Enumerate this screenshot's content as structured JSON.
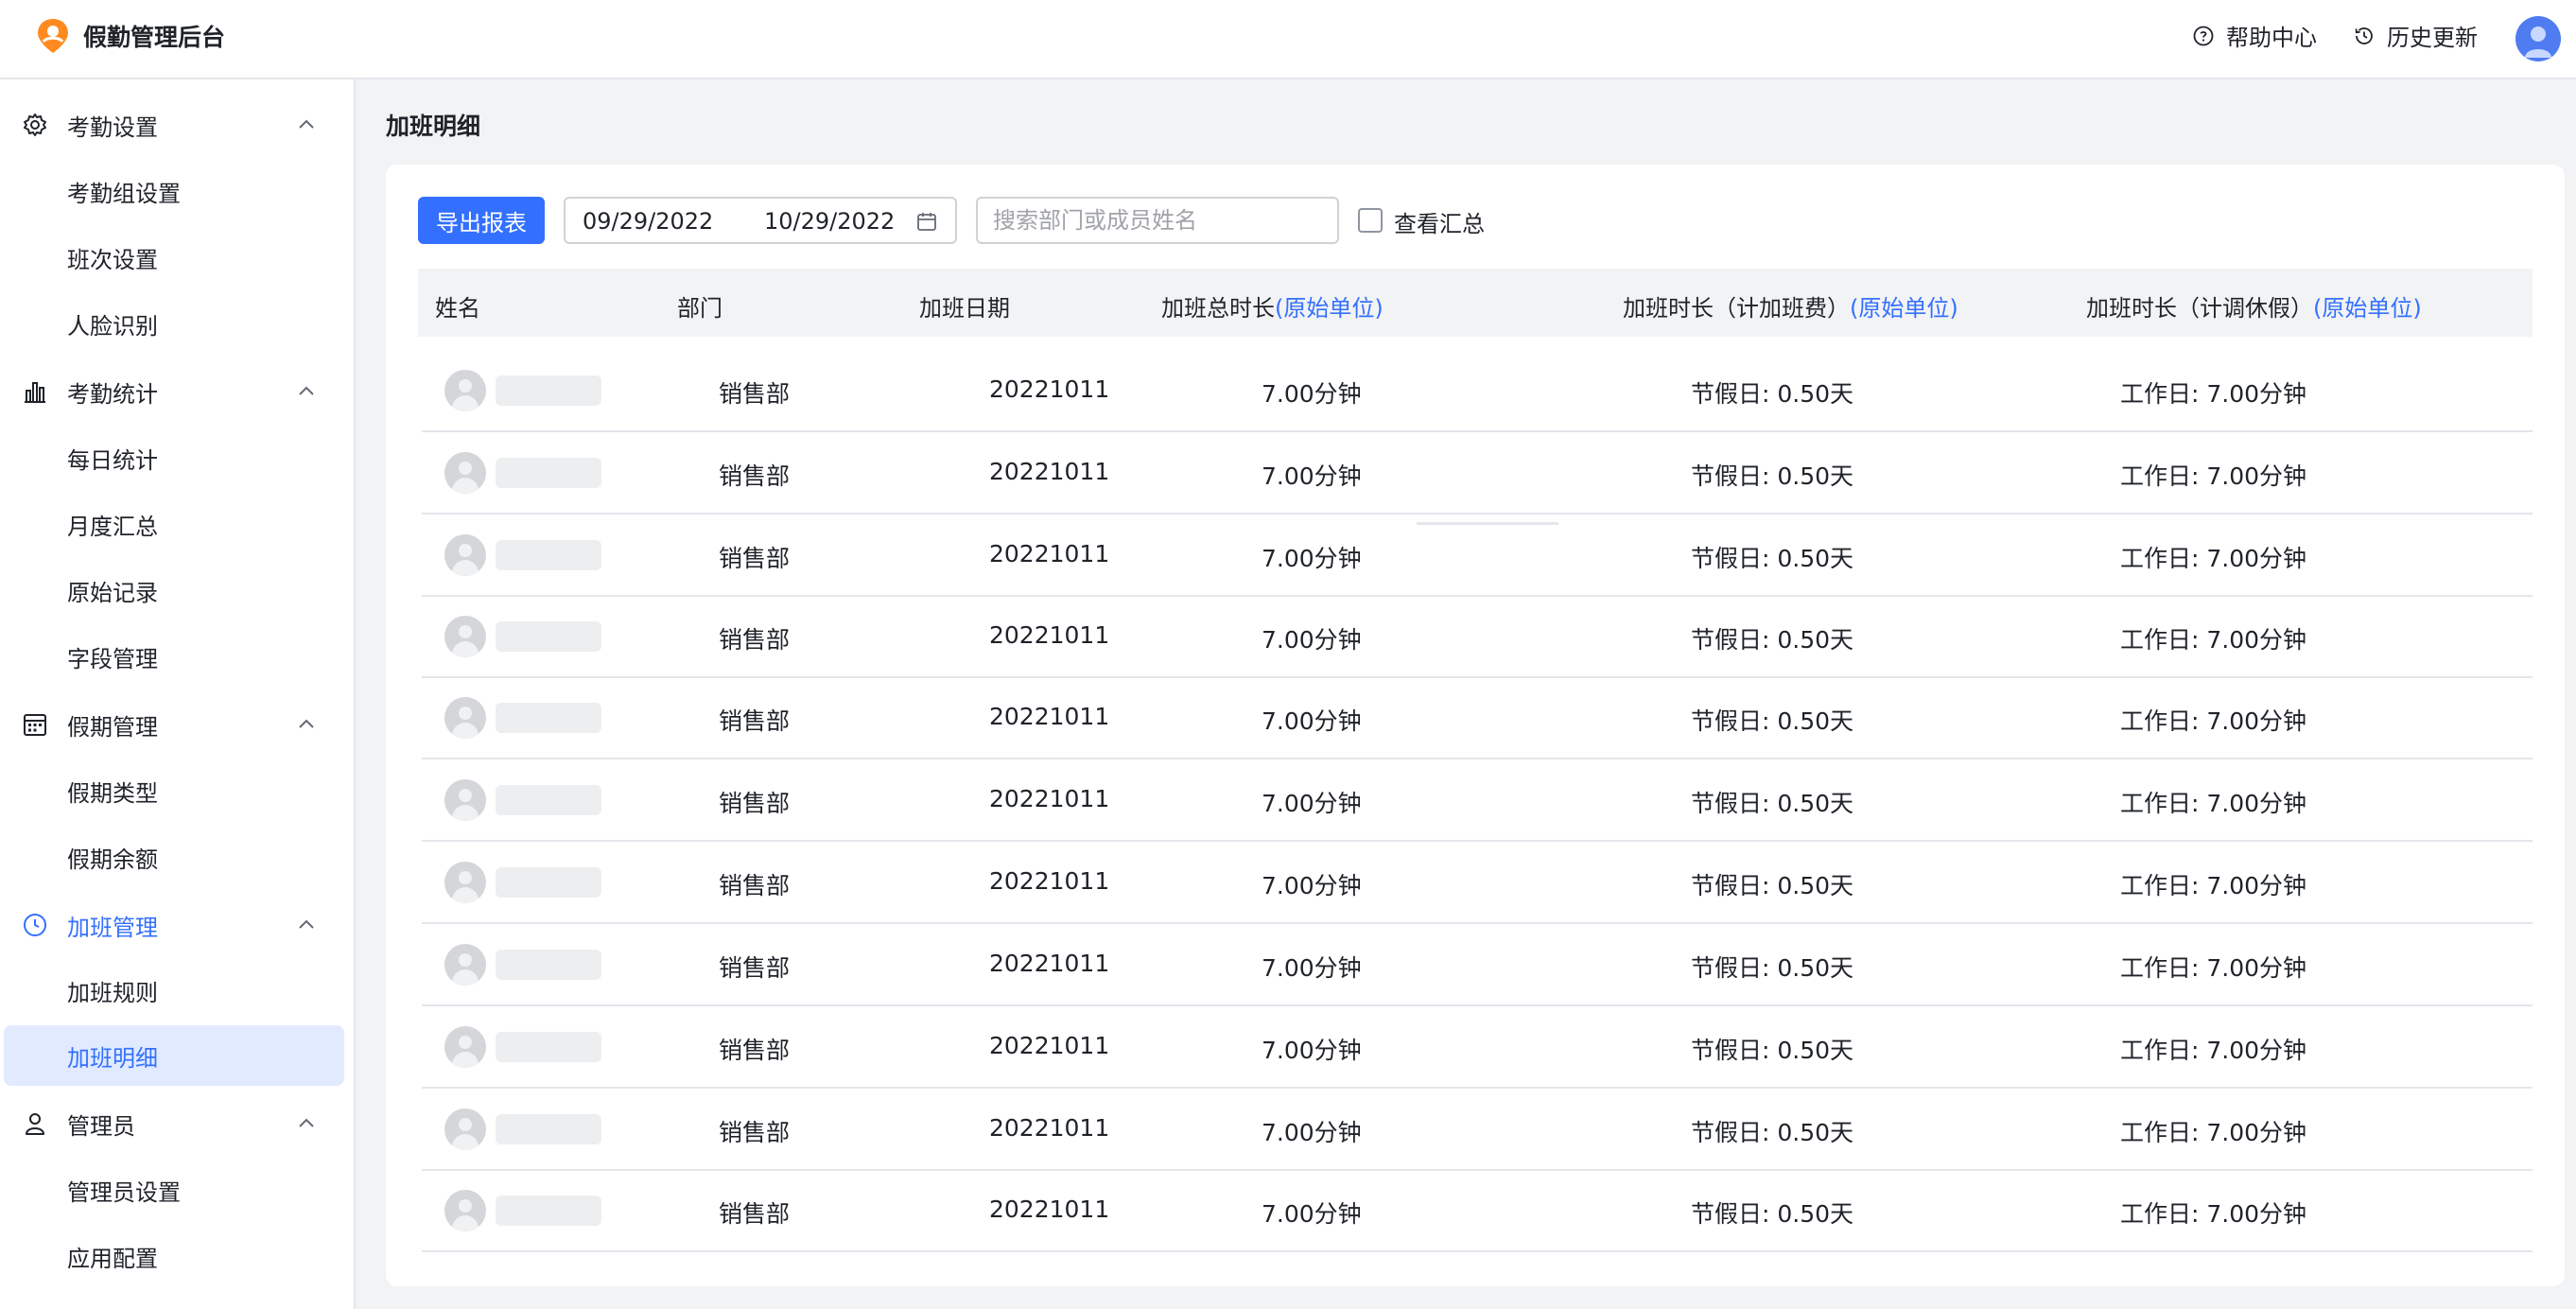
{
  "header": {
    "app_title": "假勤管理后台",
    "help_label": "帮助中心",
    "history_label": "历史更新",
    "icons": {
      "logo": "location-pin-logo-icon",
      "help": "question-circle-icon",
      "history": "history-clock-icon",
      "user": "user-avatar-icon"
    }
  },
  "sidebar": {
    "groups": [
      {
        "label": "考勤设置",
        "icon": "gear-icon",
        "items": [
          "考勤组设置",
          "班次设置",
          "人脸识别"
        ]
      },
      {
        "label": "考勤统计",
        "icon": "bar-chart-icon",
        "items": [
          "每日统计",
          "月度汇总",
          "原始记录",
          "字段管理"
        ]
      },
      {
        "label": "假期管理",
        "icon": "calendar-grid-icon",
        "items": [
          "假期类型",
          "假期余额"
        ]
      },
      {
        "label": "加班管理",
        "icon": "clock-icon",
        "items": [
          "加班规则",
          "加班明细"
        ]
      },
      {
        "label": "管理员",
        "icon": "person-icon",
        "items": [
          "管理员设置",
          "应用配置"
        ]
      }
    ],
    "active_group": "加班管理",
    "selected_item": "加班明细"
  },
  "page": {
    "title": "加班明细"
  },
  "toolbar": {
    "export_label": "导出报表",
    "date_start": "09/29/2022",
    "date_end": "10/29/2022",
    "search_placeholder": "搜索部门或成员姓名",
    "summary_label": "查看汇总",
    "summary_checked": false
  },
  "table": {
    "headers": {
      "name": "姓名",
      "dept": "部门",
      "date": "加班日期",
      "total": "加班总时长",
      "pay": "加班时长（计加班费）",
      "leave": "加班时长（计调休假）",
      "unit": "(原始单位)"
    },
    "rows": [
      {
        "dept": "销售部",
        "date": "20221011",
        "total": "7.00分钟",
        "pay": "节假日: 0.50天",
        "leave": "工作日: 7.00分钟"
      },
      {
        "dept": "销售部",
        "date": "20221011",
        "total": "7.00分钟",
        "pay": "节假日: 0.50天",
        "leave": "工作日: 7.00分钟"
      },
      {
        "dept": "销售部",
        "date": "20221011",
        "total": "7.00分钟",
        "pay": "节假日: 0.50天",
        "leave": "工作日: 7.00分钟"
      },
      {
        "dept": "销售部",
        "date": "20221011",
        "total": "7.00分钟",
        "pay": "节假日: 0.50天",
        "leave": "工作日: 7.00分钟"
      },
      {
        "dept": "销售部",
        "date": "20221011",
        "total": "7.00分钟",
        "pay": "节假日: 0.50天",
        "leave": "工作日: 7.00分钟"
      },
      {
        "dept": "销售部",
        "date": "20221011",
        "total": "7.00分钟",
        "pay": "节假日: 0.50天",
        "leave": "工作日: 7.00分钟"
      },
      {
        "dept": "销售部",
        "date": "20221011",
        "total": "7.00分钟",
        "pay": "节假日: 0.50天",
        "leave": "工作日: 7.00分钟"
      },
      {
        "dept": "销售部",
        "date": "20221011",
        "total": "7.00分钟",
        "pay": "节假日: 0.50天",
        "leave": "工作日: 7.00分钟"
      },
      {
        "dept": "销售部",
        "date": "20221011",
        "total": "7.00分钟",
        "pay": "节假日: 0.50天",
        "leave": "工作日: 7.00分钟"
      },
      {
        "dept": "销售部",
        "date": "20221011",
        "total": "7.00分钟",
        "pay": "节假日: 0.50天",
        "leave": "工作日: 7.00分钟"
      },
      {
        "dept": "销售部",
        "date": "20221011",
        "total": "7.00分钟",
        "pay": "节假日: 0.50天",
        "leave": "工作日: 7.00分钟"
      }
    ]
  },
  "colors": {
    "accent": "#3370ff",
    "selected_bg": "#e1eaff",
    "header_bg": "#f2f3f5",
    "logo": "#ff8a1f"
  }
}
